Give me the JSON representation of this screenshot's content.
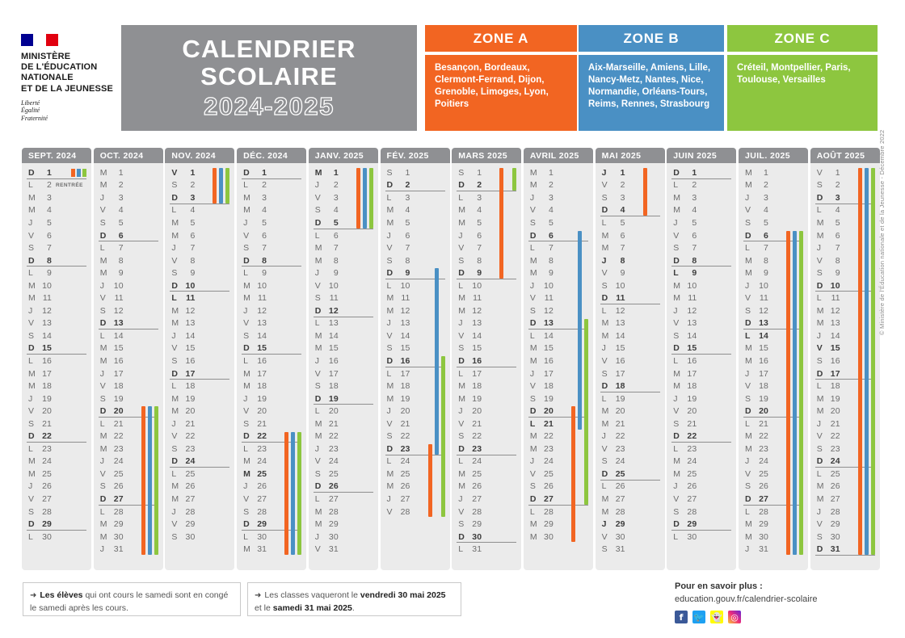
{
  "header": {
    "logo": {
      "flag_colors": [
        "#000091",
        "#ffffff",
        "#E1000F"
      ],
      "ministry_lines": "MINISTÈRE\nDE L'ÉDUCATION\nNATIONALE\nET DE LA JEUNESSE",
      "motto_lines": "Liberté\nÉgalité\nFraternité"
    },
    "title_line1": "CALENDRIER",
    "title_line2": "SCOLAIRE",
    "title_year": "2024-2025"
  },
  "zones": [
    {
      "key": "A",
      "label": "ZONE A",
      "color": "#F26522",
      "academies": "Besançon, Bordeaux, Clermont-Ferrand, Dijon, Grenoble, Limoges, Lyon, Poitiers"
    },
    {
      "key": "B",
      "label": "ZONE B",
      "color": "#4A90C4",
      "academies": "Aix-Marseille, Amiens, Lille, Nancy-Metz, Nantes, Nice, Normandie, Orléans-Tours, Reims, Rennes, Strasbourg"
    },
    {
      "key": "C",
      "label": "ZONE C",
      "color": "#8DC63F",
      "academies": "Créteil, Montpellier, Paris, Toulouse, Versailles"
    }
  ],
  "calendar": {
    "day_letters": {
      "monday": "L",
      "tuesday": "M",
      "wednesday": "M",
      "thursday": "J",
      "friday": "V",
      "saturday": "S",
      "sunday": "D"
    },
    "months": [
      {
        "label": "SEPT. 2024",
        "year": 2024,
        "month": 9,
        "days": 30,
        "first_dow": 7,
        "bold_days": [
          1,
          8,
          15,
          22,
          29
        ],
        "notes": {
          "2": "RENTRÉE"
        },
        "chips_day": 1,
        "bars": []
      },
      {
        "label": "OCT. 2024",
        "year": 2024,
        "month": 10,
        "days": 31,
        "first_dow": 2,
        "bold_days": [
          6,
          13,
          20,
          27
        ],
        "notes": {},
        "bars": [
          {
            "zone": "A",
            "from": 20,
            "to": 31
          },
          {
            "zone": "B",
            "from": 20,
            "to": 31
          },
          {
            "zone": "C",
            "from": 20,
            "to": 31
          }
        ]
      },
      {
        "label": "NOV. 2024",
        "year": 2024,
        "month": 11,
        "days": 30,
        "first_dow": 5,
        "bold_days": [
          1,
          3,
          10,
          11,
          17,
          24
        ],
        "notes": {},
        "bars": [
          {
            "zone": "A",
            "from": 1,
            "to": 3
          },
          {
            "zone": "B",
            "from": 1,
            "to": 3
          },
          {
            "zone": "C",
            "from": 1,
            "to": 3
          }
        ]
      },
      {
        "label": "DÉC. 2024",
        "year": 2024,
        "month": 12,
        "days": 31,
        "first_dow": 7,
        "bold_days": [
          1,
          8,
          15,
          22,
          25,
          29
        ],
        "notes": {},
        "bars": [
          {
            "zone": "A",
            "from": 22,
            "to": 31
          },
          {
            "zone": "B",
            "from": 22,
            "to": 31
          },
          {
            "zone": "C",
            "from": 22,
            "to": 31
          }
        ]
      },
      {
        "label": "JANV. 2025",
        "year": 2025,
        "month": 1,
        "days": 31,
        "first_dow": 3,
        "bold_days": [
          1,
          5,
          12,
          19,
          26
        ],
        "notes": {},
        "bars": [
          {
            "zone": "A",
            "from": 1,
            "to": 5
          },
          {
            "zone": "B",
            "from": 1,
            "to": 5
          },
          {
            "zone": "C",
            "from": 1,
            "to": 5
          }
        ]
      },
      {
        "label": "FÉV. 2025",
        "year": 2025,
        "month": 2,
        "days": 28,
        "first_dow": 6,
        "bold_days": [
          2,
          9,
          16,
          23
        ],
        "notes": {},
        "bars": [
          {
            "zone": "B",
            "from": 9,
            "to": 23
          },
          {
            "zone": "C",
            "from": 16,
            "to": 28
          },
          {
            "zone": "A",
            "from": 23,
            "to": 28
          }
        ]
      },
      {
        "label": "MARS 2025",
        "year": 2025,
        "month": 3,
        "days": 31,
        "first_dow": 6,
        "bold_days": [
          2,
          9,
          16,
          23,
          30
        ],
        "notes": {},
        "bars": [
          {
            "zone": "A",
            "from": 1,
            "to": 9
          },
          {
            "zone": "C",
            "from": 1,
            "to": 2
          }
        ]
      },
      {
        "label": "AVRIL 2025",
        "year": 2025,
        "month": 4,
        "days": 30,
        "first_dow": 2,
        "bold_days": [
          6,
          13,
          20,
          21,
          27
        ],
        "notes": {},
        "bars": [
          {
            "zone": "B",
            "from": 6,
            "to": 21
          },
          {
            "zone": "C",
            "from": 13,
            "to": 27
          },
          {
            "zone": "A",
            "from": 20,
            "to": 30
          }
        ]
      },
      {
        "label": "MAI 2025",
        "year": 2025,
        "month": 5,
        "days": 31,
        "first_dow": 4,
        "bold_days": [
          1,
          4,
          8,
          11,
          18,
          25,
          29
        ],
        "notes": {},
        "bars": [
          {
            "zone": "A",
            "from": 1,
            "to": 4
          }
        ]
      },
      {
        "label": "JUIN 2025",
        "year": 2025,
        "month": 6,
        "days": 30,
        "first_dow": 7,
        "bold_days": [
          1,
          8,
          9,
          15,
          22,
          29
        ],
        "notes": {},
        "bars": []
      },
      {
        "label": "JUIL. 2025",
        "year": 2025,
        "month": 7,
        "days": 31,
        "first_dow": 2,
        "bold_days": [
          6,
          13,
          14,
          20,
          27
        ],
        "notes": {},
        "bars": [
          {
            "zone": "A",
            "from": 6,
            "to": 31
          },
          {
            "zone": "B",
            "from": 6,
            "to": 31
          },
          {
            "zone": "C",
            "from": 6,
            "to": 31
          }
        ]
      },
      {
        "label": "AOÛT 2025",
        "year": 2025,
        "month": 8,
        "days": 31,
        "first_dow": 5,
        "bold_days": [
          3,
          10,
          15,
          17,
          24,
          31
        ],
        "notes": {},
        "bars": [
          {
            "zone": "A",
            "from": 1,
            "to": 31
          },
          {
            "zone": "B",
            "from": 1,
            "to": 31
          },
          {
            "zone": "C",
            "from": 1,
            "to": 31
          }
        ]
      }
    ]
  },
  "footer": {
    "note1_html": "<b>Les élèves</b> qui ont cours le samedi sont en congé le samedi après les cours.",
    "note1_plain": "Les élèves qui ont cours le samedi sont en congé le samedi après les cours.",
    "note2_html": "Les classes vaqueront le <b>vendredi 30 mai 2025</b> et le <b>samedi 31 mai 2025</b>.",
    "note2_plain": "Les classes vaqueront le vendredi 30 mai 2025 et le samedi 31 mai 2025.",
    "arrow_glyph": "➜",
    "more_title": "Pour en savoir plus :",
    "more_url": "education.gouv.fr/calendrier-scolaire",
    "social": [
      {
        "name": "facebook-icon",
        "glyph": "f",
        "color": "#3b5998"
      },
      {
        "name": "twitter-icon",
        "glyph": "🐦",
        "color": "#1da1f2"
      },
      {
        "name": "snapchat-icon",
        "glyph": "👻",
        "color": "#FFFC00"
      },
      {
        "name": "instagram-icon",
        "glyph": "◎",
        "color": "#ee2a7b"
      }
    ],
    "copyright": "© Ministère de l'Éducation nationale et de la Jeunesse - Décembre 2022"
  },
  "palette": {
    "zone_a": "#F26522",
    "zone_b": "#4A90C4",
    "zone_c": "#8DC63F",
    "header_grey": "#8f9093",
    "column_bg": "#ebebeb"
  }
}
